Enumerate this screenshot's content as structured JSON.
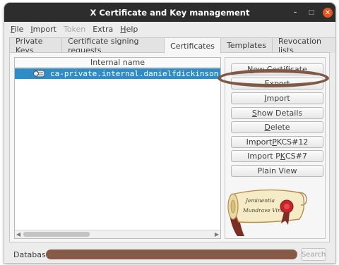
{
  "window": {
    "title": "X Certificate and Key management"
  },
  "menubar": {
    "items": [
      {
        "label": "File",
        "mnemonic": "F",
        "rest": "ile",
        "enabled": true
      },
      {
        "label": "Import",
        "mnemonic": "I",
        "rest": "mport",
        "enabled": true
      },
      {
        "label": "Token",
        "enabled": false
      },
      {
        "label": "Extra",
        "enabled": true
      },
      {
        "label": "Help",
        "mnemonic": "H",
        "rest": "elp",
        "enabled": true
      }
    ]
  },
  "tabs": [
    {
      "label": "Private Keys",
      "active": false
    },
    {
      "label": "Certificate signing requests",
      "active": false
    },
    {
      "label": "Certificates",
      "active": true
    },
    {
      "label": "Templates",
      "active": false
    },
    {
      "label": "Revocation lists",
      "active": false
    }
  ],
  "tree": {
    "header": "Internal name",
    "rows": [
      {
        "name": "ca-private.internal.danielfdickinson",
        "selected": true
      }
    ]
  },
  "buttons": {
    "new_certificate": {
      "pre": "",
      "mn": "N",
      "post": "ew Certificate"
    },
    "export": {
      "pre": "",
      "mn": "E",
      "post": "xport"
    },
    "import": {
      "pre": "",
      "mn": "I",
      "post": "mport"
    },
    "show_details": {
      "pre": "",
      "mn": "S",
      "post": "how Details"
    },
    "delete": {
      "pre": "",
      "mn": "D",
      "post": "elete"
    },
    "import_pkcs12": {
      "pre": "Import ",
      "mn": "P",
      "post": "KCS#12"
    },
    "import_pkcs7": {
      "pre": "Import P",
      "mn": "K",
      "post": "CS#7"
    },
    "plain_view": {
      "pre": "Plain View",
      "mn": "",
      "post": ""
    }
  },
  "logo": {
    "line1": "Jeminentia",
    "line2": "Mundrave Vins"
  },
  "status": {
    "label": "Database",
    "search_label": "Search"
  },
  "colors": {
    "selection": "#308cc6",
    "highlight": "#805846",
    "close": "#e95420"
  }
}
